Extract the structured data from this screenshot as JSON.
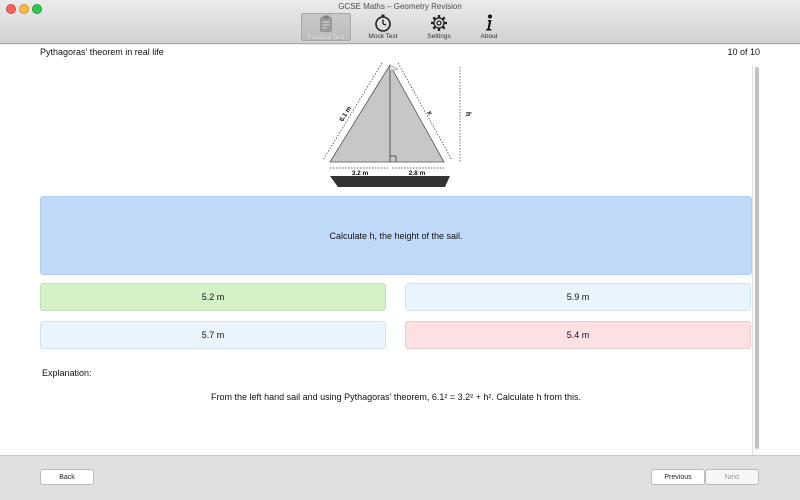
{
  "window": {
    "title": "GCSE Maths – Geometry Revision"
  },
  "toolbar": {
    "items": [
      {
        "label": "Practice Test",
        "icon": "clipboard-icon",
        "active": true
      },
      {
        "label": "Mock Test",
        "icon": "stopwatch-icon",
        "active": false
      },
      {
        "label": "Settings",
        "icon": "gear-icon",
        "active": false
      },
      {
        "label": "About",
        "icon": "info-icon",
        "active": false
      }
    ]
  },
  "question_header": {
    "topic": "Pythagoras' theorem in real life",
    "counter": "10 of 10"
  },
  "diagram": {
    "left_side_label": "6.1 m",
    "right_side_label": "x",
    "height_label": "h",
    "left_base_label": "3.2 m",
    "right_base_label": "2.8 m"
  },
  "question": {
    "text": "Calculate h, the height of the sail."
  },
  "answers": [
    {
      "label": "5.2 m",
      "state": "correct"
    },
    {
      "label": "5.9 m",
      "state": "neutral"
    },
    {
      "label": "5.7 m",
      "state": "neutral"
    },
    {
      "label": "5.4 m",
      "state": "wrong"
    }
  ],
  "explanation": {
    "label": "Explanation:",
    "text": "From the left hand sail and using Pythagoras' theorem, 6.1² = 3.2² + h². Calculate h from this."
  },
  "footer": {
    "back_label": "Back",
    "previous_label": "Previous",
    "next_label": "Next"
  },
  "colors": {
    "question_bg": "#c1d9f9",
    "correct_bg": "#d5f1c8",
    "wrong_bg": "#fde0e2",
    "neutral_bg": "#eaf4fd"
  }
}
